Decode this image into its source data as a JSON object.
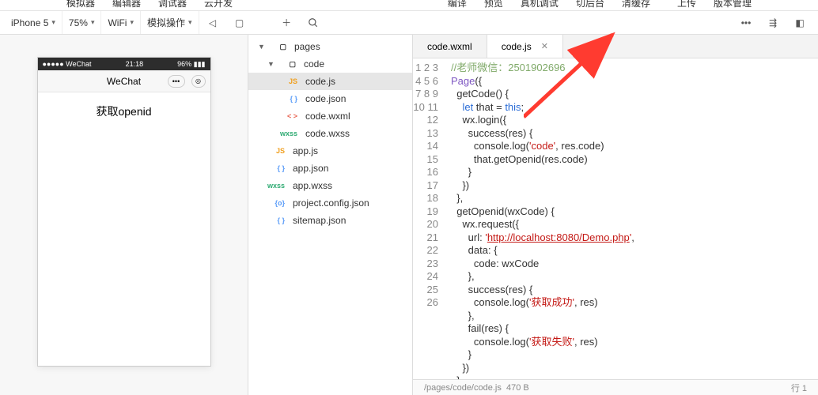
{
  "menu": {
    "items_left": [
      "模拟器",
      "编辑器",
      "调试器",
      "云开发"
    ],
    "items_right": [
      "编译",
      "预览",
      "真机调试",
      "切后台",
      "清缓存 ",
      "上传",
      "版本管理"
    ]
  },
  "toolbar": {
    "device": "iPhone 5",
    "zoom": "75%",
    "network": "WiFi",
    "simops": "模拟操作"
  },
  "phone": {
    "carrier": "●●●●● WeChat",
    "time": "21:18",
    "battery": "96% ▮▮▮",
    "title": "WeChat",
    "button": "获取openid"
  },
  "tree": {
    "root": "pages",
    "sub": "code",
    "codeFiles": [
      {
        "t": "JS",
        "n": "code.js",
        "sel": true
      },
      {
        "t": "{ }",
        "n": "code.json"
      },
      {
        "t": "< >",
        "n": "code.wxml"
      },
      {
        "t": "wxss",
        "n": "code.wxss"
      }
    ],
    "rootFiles": [
      {
        "t": "JS",
        "n": "app.js",
        "ft": "js"
      },
      {
        "t": "{ }",
        "n": "app.json",
        "ft": "json"
      },
      {
        "t": "wxss",
        "n": "app.wxss",
        "ft": "wxss"
      },
      {
        "t": "{o}",
        "n": "project.config.json",
        "ft": "json"
      },
      {
        "t": "{ }",
        "n": "sitemap.json",
        "ft": "json"
      }
    ]
  },
  "tabs": [
    {
      "label": "code.wxml"
    },
    {
      "label": "code.js",
      "active": true
    }
  ],
  "code": {
    "lines": [
      [
        {
          "t": "//老师微信：2501902696",
          "c": "tk-g"
        }
      ],
      [
        {
          "t": "Page",
          "c": "tk-p"
        },
        {
          "t": "({"
        }
      ],
      [
        {
          "t": "  getCode() {"
        }
      ],
      [
        {
          "t": "    "
        },
        {
          "t": "let",
          "c": "tk-b"
        },
        {
          "t": " that = "
        },
        {
          "t": "this",
          "c": "tk-b"
        },
        {
          "t": ";"
        }
      ],
      [
        {
          "t": "    wx.login({"
        }
      ],
      [
        {
          "t": "      success(res) {"
        }
      ],
      [
        {
          "t": "        console.log("
        },
        {
          "t": "'code'",
          "c": "tk-s"
        },
        {
          "t": ", res.code)"
        }
      ],
      [
        {
          "t": "        that.getOpenid(res.code)"
        }
      ],
      [
        {
          "t": "      }"
        }
      ],
      [
        {
          "t": "    })"
        }
      ],
      [
        {
          "t": "  },"
        }
      ],
      [
        {
          "t": "  getOpenid(wxCode) {"
        }
      ],
      [
        {
          "t": "    wx.request({"
        }
      ],
      [
        {
          "t": "      url: "
        },
        {
          "t": "'",
          "c": "tk-s"
        },
        {
          "t": "http://localhost:8080/Demo.php",
          "c": "tk-u"
        },
        {
          "t": "'",
          "c": "tk-s"
        },
        {
          "t": ","
        }
      ],
      [
        {
          "t": "      data: {"
        }
      ],
      [
        {
          "t": "        code: wxCode"
        }
      ],
      [
        {
          "t": "      },"
        }
      ],
      [
        {
          "t": "      success(res) {"
        }
      ],
      [
        {
          "t": "        console.log("
        },
        {
          "t": "'获取成功'",
          "c": "tk-s"
        },
        {
          "t": ", res)"
        }
      ],
      [
        {
          "t": "      },"
        }
      ],
      [
        {
          "t": "      fail(res) {"
        }
      ],
      [
        {
          "t": "        console.log("
        },
        {
          "t": "'获取失败'",
          "c": "tk-s"
        },
        {
          "t": ", res)"
        }
      ],
      [
        {
          "t": "      }"
        }
      ],
      [
        {
          "t": "    })"
        }
      ],
      [
        {
          "t": "  }"
        }
      ],
      [
        {
          "t": ""
        }
      ]
    ]
  },
  "footer": {
    "path": "/pages/code/code.js",
    "size": "470 B",
    "pos": "行 1"
  }
}
